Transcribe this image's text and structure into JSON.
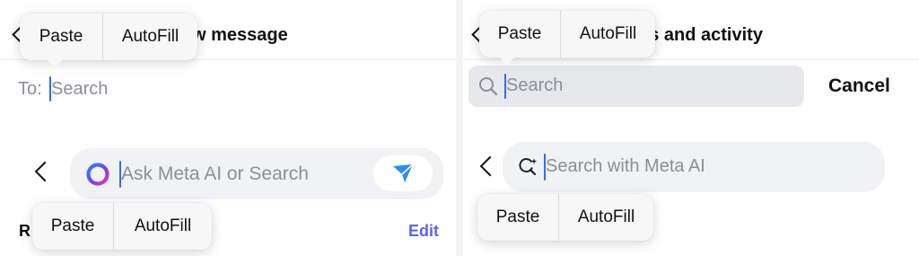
{
  "left": {
    "header": {
      "title_fragment": "w message"
    },
    "top_menu": {
      "paste": "Paste",
      "autofill": "AutoFill"
    },
    "to_field": {
      "label": "To:",
      "placeholder": "Search"
    },
    "meta_bar": {
      "placeholder": "Ask Meta AI or Search"
    },
    "bottom_menu": {
      "paste": "Paste",
      "autofill": "AutoFill"
    },
    "section": {
      "letter": "R",
      "edit": "Edit"
    }
  },
  "right": {
    "header": {
      "title_fragment": "gs and activity"
    },
    "top_menu": {
      "paste": "Paste",
      "autofill": "AutoFill"
    },
    "search": {
      "placeholder": "Search",
      "cancel": "Cancel"
    },
    "meta_bar": {
      "placeholder": "Search with Meta AI"
    },
    "bottom_menu": {
      "paste": "Paste",
      "autofill": "AutoFill"
    }
  },
  "colors": {
    "cursor": "#2f6bff",
    "send_arrow": "#2b8cff",
    "edit_link": "#5b67e8",
    "placeholder": "#8a8f98"
  },
  "icons": [
    "back-chevron-icon",
    "meta-ai-ring-icon",
    "send-icon",
    "search-icon",
    "meta-ai-search-icon"
  ]
}
